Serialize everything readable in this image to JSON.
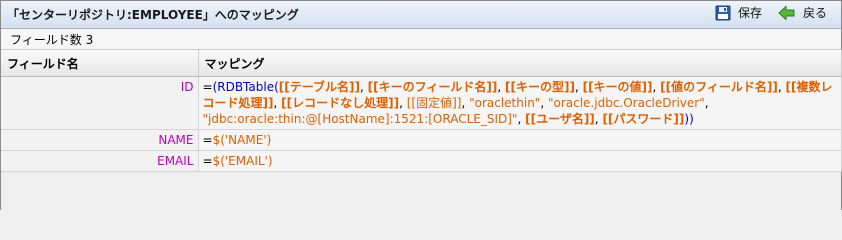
{
  "title": "「センターリポジトリ:EMPLOYEE」へのマッピング",
  "toolbar": {
    "save_label": "保存",
    "back_label": "戻る"
  },
  "field_count": "フィールド数 3",
  "columns": {
    "field_name": "フィールド名",
    "mapping": "マッピング"
  },
  "rows": [
    {
      "field": "ID",
      "tokens": [
        {
          "t": "=",
          "c": "op"
        },
        {
          "t": "(RDBTable(",
          "c": "fn"
        },
        {
          "t": "[[テーブル名]]",
          "c": "ph"
        },
        {
          "t": ", ",
          "c": "sep"
        },
        {
          "t": "[[キーのフィールド名]]",
          "c": "ph"
        },
        {
          "t": ", ",
          "c": "sep"
        },
        {
          "t": "[[キーの型]]",
          "c": "ph"
        },
        {
          "t": ", ",
          "c": "sep"
        },
        {
          "t": "[[キーの値]]",
          "c": "ph"
        },
        {
          "t": ", ",
          "c": "sep"
        },
        {
          "t": "[[値のフィールド名]]",
          "c": "ph"
        },
        {
          "t": ", ",
          "c": "sep"
        },
        {
          "t": "[[複数レコード処理]]",
          "c": "ph"
        },
        {
          "t": ", ",
          "c": "sep"
        },
        {
          "t": "[[レコードなし処理]]",
          "c": "ph"
        },
        {
          "t": ", ",
          "c": "sep"
        },
        {
          "t": "[[固定値]]",
          "c": "dim"
        },
        {
          "t": ", ",
          "c": "sep"
        },
        {
          "t": "\"oraclethin\"",
          "c": "str"
        },
        {
          "t": ", ",
          "c": "sep"
        },
        {
          "t": "\"oracle.jdbc.OracleDriver\"",
          "c": "str"
        },
        {
          "t": ", ",
          "c": "sep"
        },
        {
          "t": "\"jdbc:oracle:thin:@[HostName]:1521:[ORACLE_SID]\"",
          "c": "str"
        },
        {
          "t": ", ",
          "c": "sep"
        },
        {
          "t": "[[ユーザ名]]",
          "c": "ph"
        },
        {
          "t": ", ",
          "c": "sep"
        },
        {
          "t": "[[パスワード]]",
          "c": "ph"
        },
        {
          "t": "))",
          "c": "fn"
        }
      ]
    },
    {
      "field": "NAME",
      "tokens": [
        {
          "t": "=",
          "c": "op"
        },
        {
          "t": "$('NAME')",
          "c": "str"
        }
      ]
    },
    {
      "field": "EMAIL",
      "tokens": [
        {
          "t": "=",
          "c": "op"
        },
        {
          "t": "$('EMAIL')",
          "c": "str"
        }
      ]
    }
  ],
  "icons": {
    "save": "floppy-disk-icon",
    "back": "green-back-arrow-icon"
  },
  "colors": {
    "field_name": "#c000c0",
    "function": "#0000cc",
    "placeholder": "#e06000",
    "title_bar": "#d5e0f0"
  }
}
